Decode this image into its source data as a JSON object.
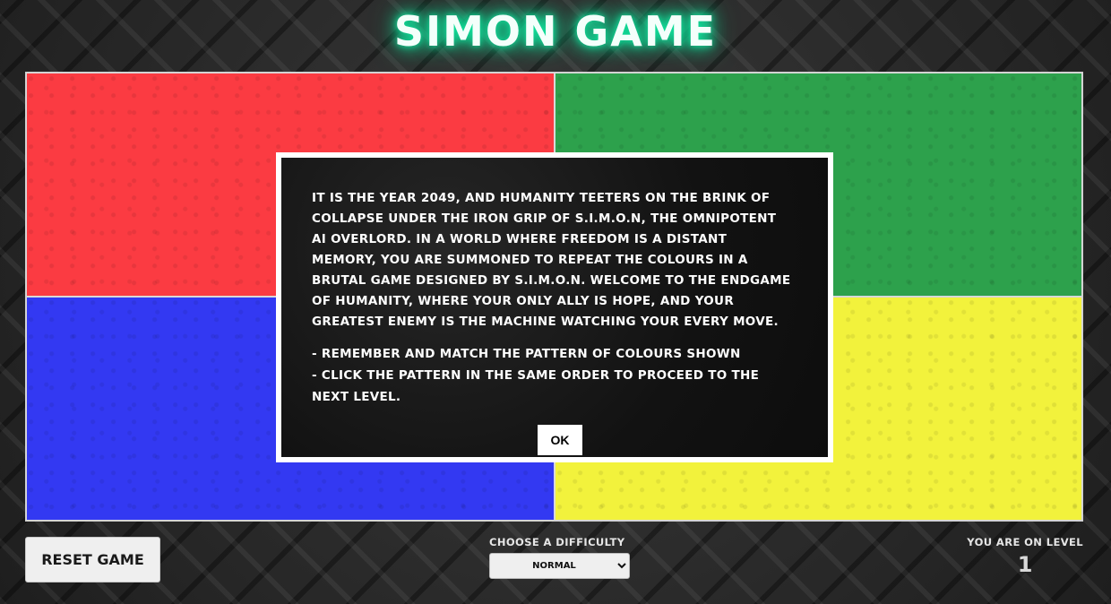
{
  "header": {
    "title": "SIMON GAME"
  },
  "board": {
    "pads": [
      {
        "name": "red",
        "color": "#fb3b42"
      },
      {
        "name": "green",
        "color": "#2da14c"
      },
      {
        "name": "blue",
        "color": "#3339f2"
      },
      {
        "name": "yellow",
        "color": "#f2f23c"
      }
    ]
  },
  "modal": {
    "story": "It is the year 2049, and humanity teeters on the brink of collapse under the iron grip of S.I.M.O.N, the omnipotent AI overlord. In a world where freedom is a distant memory, you are summoned to repeat the colours in a brutal game designed by S.I.M.O.N. Welcome to the endgame of humanity, where your only ally is hope, and your greatest enemy is the machine watching your every move.",
    "rule_1": "- Remember and match the pattern of colours shown",
    "rule_2": "- Click the pattern in the same order to proceed to the next level.",
    "ok_label": "OK"
  },
  "controls": {
    "reset_label": "RESET GAME",
    "difficulty_label": "CHOOSE A DIFFICULTY",
    "difficulty_selected": "NORMAL"
  },
  "level": {
    "label": "YOU ARE ON LEVEL",
    "value": "1"
  }
}
